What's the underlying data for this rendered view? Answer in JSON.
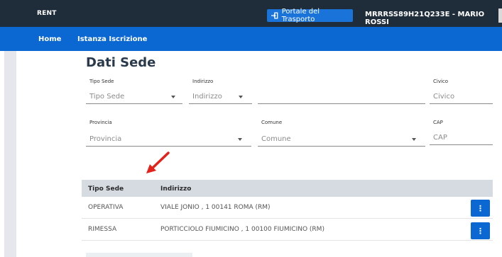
{
  "header": {
    "brand": "RENT",
    "portal_button": "Portale del Trasporto",
    "user": "MRRRSS89H21Q233E - MARIO ROSSI"
  },
  "nav": {
    "items": [
      "Home",
      "Istanza Iscrizione"
    ]
  },
  "section": {
    "title": "Dati Sede"
  },
  "form": {
    "tipo_sede": {
      "label": "Tipo Sede",
      "placeholder": "Tipo Sede"
    },
    "indirizzo": {
      "label": "Indirizzo",
      "placeholder": "Indirizzo"
    },
    "civico": {
      "label": "Civico",
      "placeholder": "Civico"
    },
    "provincia": {
      "label": "Provincia",
      "placeholder": "Provincia"
    },
    "comune": {
      "label": "Comune",
      "placeholder": "Comune"
    },
    "cap": {
      "label": "CAP",
      "placeholder": "CAP"
    }
  },
  "table": {
    "columns": [
      "Tipo Sede",
      "Indirizzo"
    ],
    "rows": [
      [
        "OPERATIVA",
        "VIALE JONIO , 1 00141 ROMA (RM)"
      ],
      [
        "RIMESSA",
        "PORTICCIOLO FIUMICINO , 1 00100 FIUMICINO (RM)"
      ]
    ],
    "action_glyph": "⋮"
  },
  "colors": {
    "topbar": "#1f2d3b",
    "navbar": "#0b67d2",
    "accent_button": "#1a73d9",
    "annotation_arrow": "#e3231b"
  },
  "icons": [
    "sign-in-icon",
    "chevron-down-icon",
    "kebab-menu-icon",
    "red-arrow-annotation"
  ]
}
